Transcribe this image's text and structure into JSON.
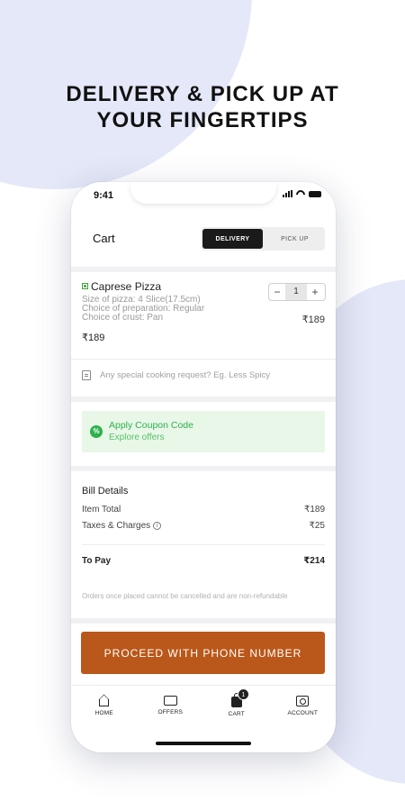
{
  "headline": {
    "line1": "DELIVERY & PICK UP AT",
    "line2": "YOUR FINGERTIPS"
  },
  "status_bar": {
    "time": "9:41"
  },
  "header": {
    "title": "Cart",
    "modes": [
      {
        "label": "DELIVERY",
        "active": true
      },
      {
        "label": "PICK UP",
        "active": false
      }
    ]
  },
  "cart_item": {
    "name": "Caprese Pizza",
    "details": [
      "Size of pizza: 4 Slice(17.5cm)",
      "Choice of preparation: Regular",
      "Choice of crust: Pan"
    ],
    "unit_price": "₹189",
    "line_total": "₹189",
    "quantity": "1",
    "minus": "−",
    "plus": "+"
  },
  "special_request": {
    "placeholder": "Any special cooking request? Eg. Less Spicy"
  },
  "coupon": {
    "icon": "%",
    "title": "Apply Coupon Code",
    "subtitle": "Explore offers"
  },
  "bill": {
    "title": "Bill Details",
    "rows": [
      {
        "label": "Item Total",
        "value": "₹189"
      },
      {
        "label": "Taxes & Charges",
        "value": "₹25"
      }
    ],
    "info_icon": "i",
    "to_pay_label": "To Pay",
    "to_pay_value": "₹214",
    "disclaimer": "Orders once placed cannot be cancelled and are non-refundable"
  },
  "cta": {
    "label": "PROCEED WITH PHONE NUMBER",
    "color": "#b9581a"
  },
  "tab_bar": {
    "tabs": [
      {
        "label": "HOME",
        "icon": "home-icon"
      },
      {
        "label": "OFFERS",
        "icon": "ticket-icon"
      },
      {
        "label": "CART",
        "icon": "bag-icon",
        "badge": "1"
      },
      {
        "label": "ACCOUNT",
        "icon": "account-icon"
      }
    ]
  },
  "colors": {
    "background_blob": "#e4e8f8",
    "coupon_green": "#2eb14a",
    "veg_green": "#3aa63a"
  }
}
